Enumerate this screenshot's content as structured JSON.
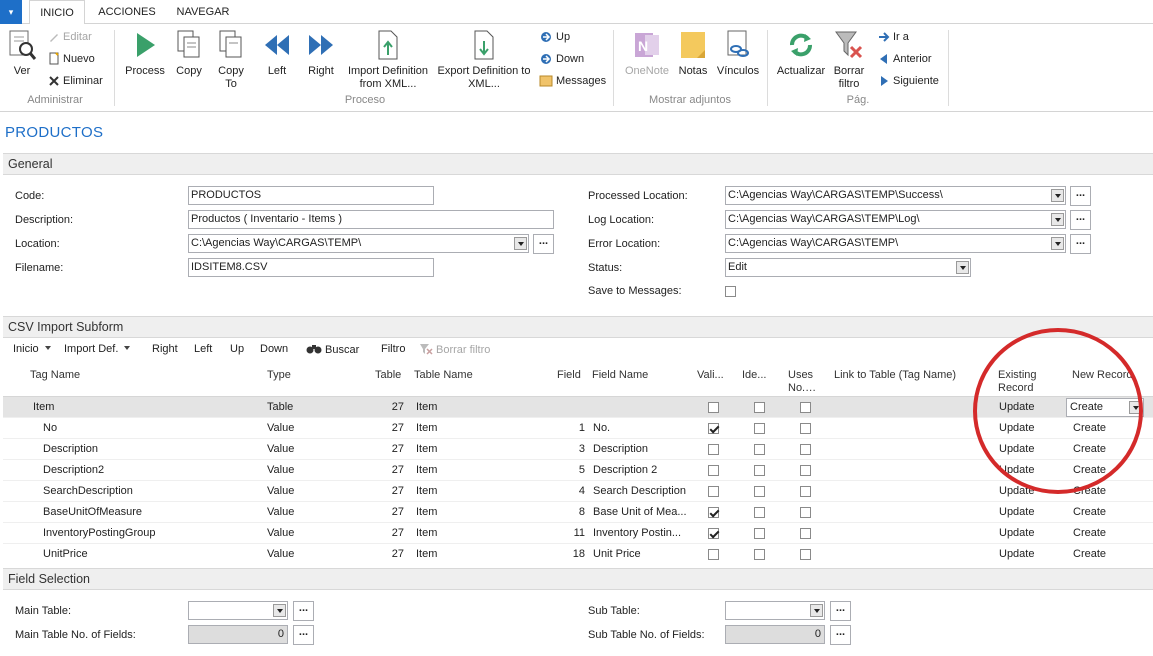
{
  "tabs": [
    "INICIO",
    "ACCIONES",
    "NAVEGAR"
  ],
  "ribbon": {
    "admin": {
      "ver": "Ver",
      "editar": "Editar",
      "nuevo": "Nuevo",
      "eliminar": "Eliminar",
      "group": "Administrar"
    },
    "proceso": {
      "process": "Process",
      "copy": "Copy",
      "copy_to": "Copy To",
      "left": "Left",
      "right": "Right",
      "import_def": "Import Definition from XML...",
      "export_def": "Export Definition to XML...",
      "up": "Up",
      "down": "Down",
      "messages": "Messages",
      "group": "Proceso"
    },
    "adjuntos": {
      "onenote": "OneNote",
      "notas": "Notas",
      "vinculos": "Vínculos",
      "group": "Mostrar adjuntos"
    },
    "pag": {
      "actualizar": "Actualizar",
      "borrar": "Borrar filtro",
      "ir": "Ir a",
      "anterior": "Anterior",
      "siguiente": "Siguiente",
      "group": "Pág."
    }
  },
  "page_title": "PRODUCTOS",
  "general": {
    "header": "General",
    "code_label": "Code:",
    "code": "PRODUCTOS",
    "desc_label": "Description:",
    "desc": "Productos ( Inventario - Items )",
    "loc_label": "Location:",
    "loc": "C:\\Agencias Way\\CARGAS\\TEMP\\",
    "fn_label": "Filename:",
    "fn": "IDSITEM8.CSV",
    "proc_label": "Processed Location:",
    "proc": "C:\\Agencias Way\\CARGAS\\TEMP\\Success\\",
    "log_label": "Log Location:",
    "log": "C:\\Agencias Way\\CARGAS\\TEMP\\Log\\",
    "err_label": "Error Location:",
    "err": "C:\\Agencias Way\\CARGAS\\TEMP\\",
    "status_label": "Status:",
    "status": "Edit",
    "stm_label": "Save to Messages:",
    "ellipsis": "..."
  },
  "subform": {
    "header": "CSV Import Subform",
    "toolbar": {
      "inicio": "Inicio",
      "import_def": "Import Def.",
      "right": "Right",
      "left": "Left",
      "up": "Up",
      "down": "Down",
      "buscar": "Buscar",
      "filtro": "Filtro",
      "borrar": "Borrar filtro"
    },
    "columns": {
      "tag": "Tag Name",
      "type": "Type",
      "table": "Table",
      "tname": "Table Name",
      "field": "Field",
      "fname": "Field Name",
      "vali": "Vali...",
      "ide": "Ide...",
      "uses": "Uses No.…",
      "link": "Link to Table (Tag Name)",
      "existing": "Existing Record",
      "newrec": "New Record"
    },
    "rows": [
      {
        "tag": "Item",
        "type": "Table",
        "table": "27",
        "tname": "Item",
        "field": "",
        "fname": "",
        "vali": false,
        "ide": false,
        "uses": false,
        "existing": "Update",
        "newrec": "Create"
      },
      {
        "tag": "No",
        "type": "Value",
        "table": "27",
        "tname": "Item",
        "field": "1",
        "fname": "No.",
        "vali": true,
        "ide": false,
        "uses": false,
        "existing": "Update",
        "newrec": "Create"
      },
      {
        "tag": "Description",
        "type": "Value",
        "table": "27",
        "tname": "Item",
        "field": "3",
        "fname": "Description",
        "vali": false,
        "ide": false,
        "uses": false,
        "existing": "Update",
        "newrec": "Create"
      },
      {
        "tag": "Description2",
        "type": "Value",
        "table": "27",
        "tname": "Item",
        "field": "5",
        "fname": "Description 2",
        "vali": false,
        "ide": false,
        "uses": false,
        "existing": "Update",
        "newrec": "Create"
      },
      {
        "tag": "SearchDescription",
        "type": "Value",
        "table": "27",
        "tname": "Item",
        "field": "4",
        "fname": "Search Description",
        "vali": false,
        "ide": false,
        "uses": false,
        "existing": "Update",
        "newrec": "Create"
      },
      {
        "tag": "BaseUnitOfMeasure",
        "type": "Value",
        "table": "27",
        "tname": "Item",
        "field": "8",
        "fname": "Base Unit of Mea...",
        "vali": true,
        "ide": false,
        "uses": false,
        "existing": "Update",
        "newrec": "Create"
      },
      {
        "tag": "InventoryPostingGroup",
        "type": "Value",
        "table": "27",
        "tname": "Item",
        "field": "11",
        "fname": "Inventory Postin...",
        "vali": true,
        "ide": false,
        "uses": false,
        "existing": "Update",
        "newrec": "Create"
      },
      {
        "tag": "UnitPrice",
        "type": "Value",
        "table": "27",
        "tname": "Item",
        "field": "18",
        "fname": "Unit Price",
        "vali": false,
        "ide": false,
        "uses": false,
        "existing": "Update",
        "newrec": "Create"
      }
    ]
  },
  "field_selection": {
    "header": "Field Selection",
    "main_table_label": "Main Table:",
    "main_table": "",
    "main_nf_label": "Main Table No. of Fields:",
    "main_nf": "0",
    "sub_table_label": "Sub Table:",
    "sub_table": "",
    "sub_nf_label": "Sub Table No. of Fields:",
    "sub_nf": "0"
  },
  "colors": {
    "accent": "#1e6fc8",
    "highlight_circle": "#d42a2a"
  }
}
